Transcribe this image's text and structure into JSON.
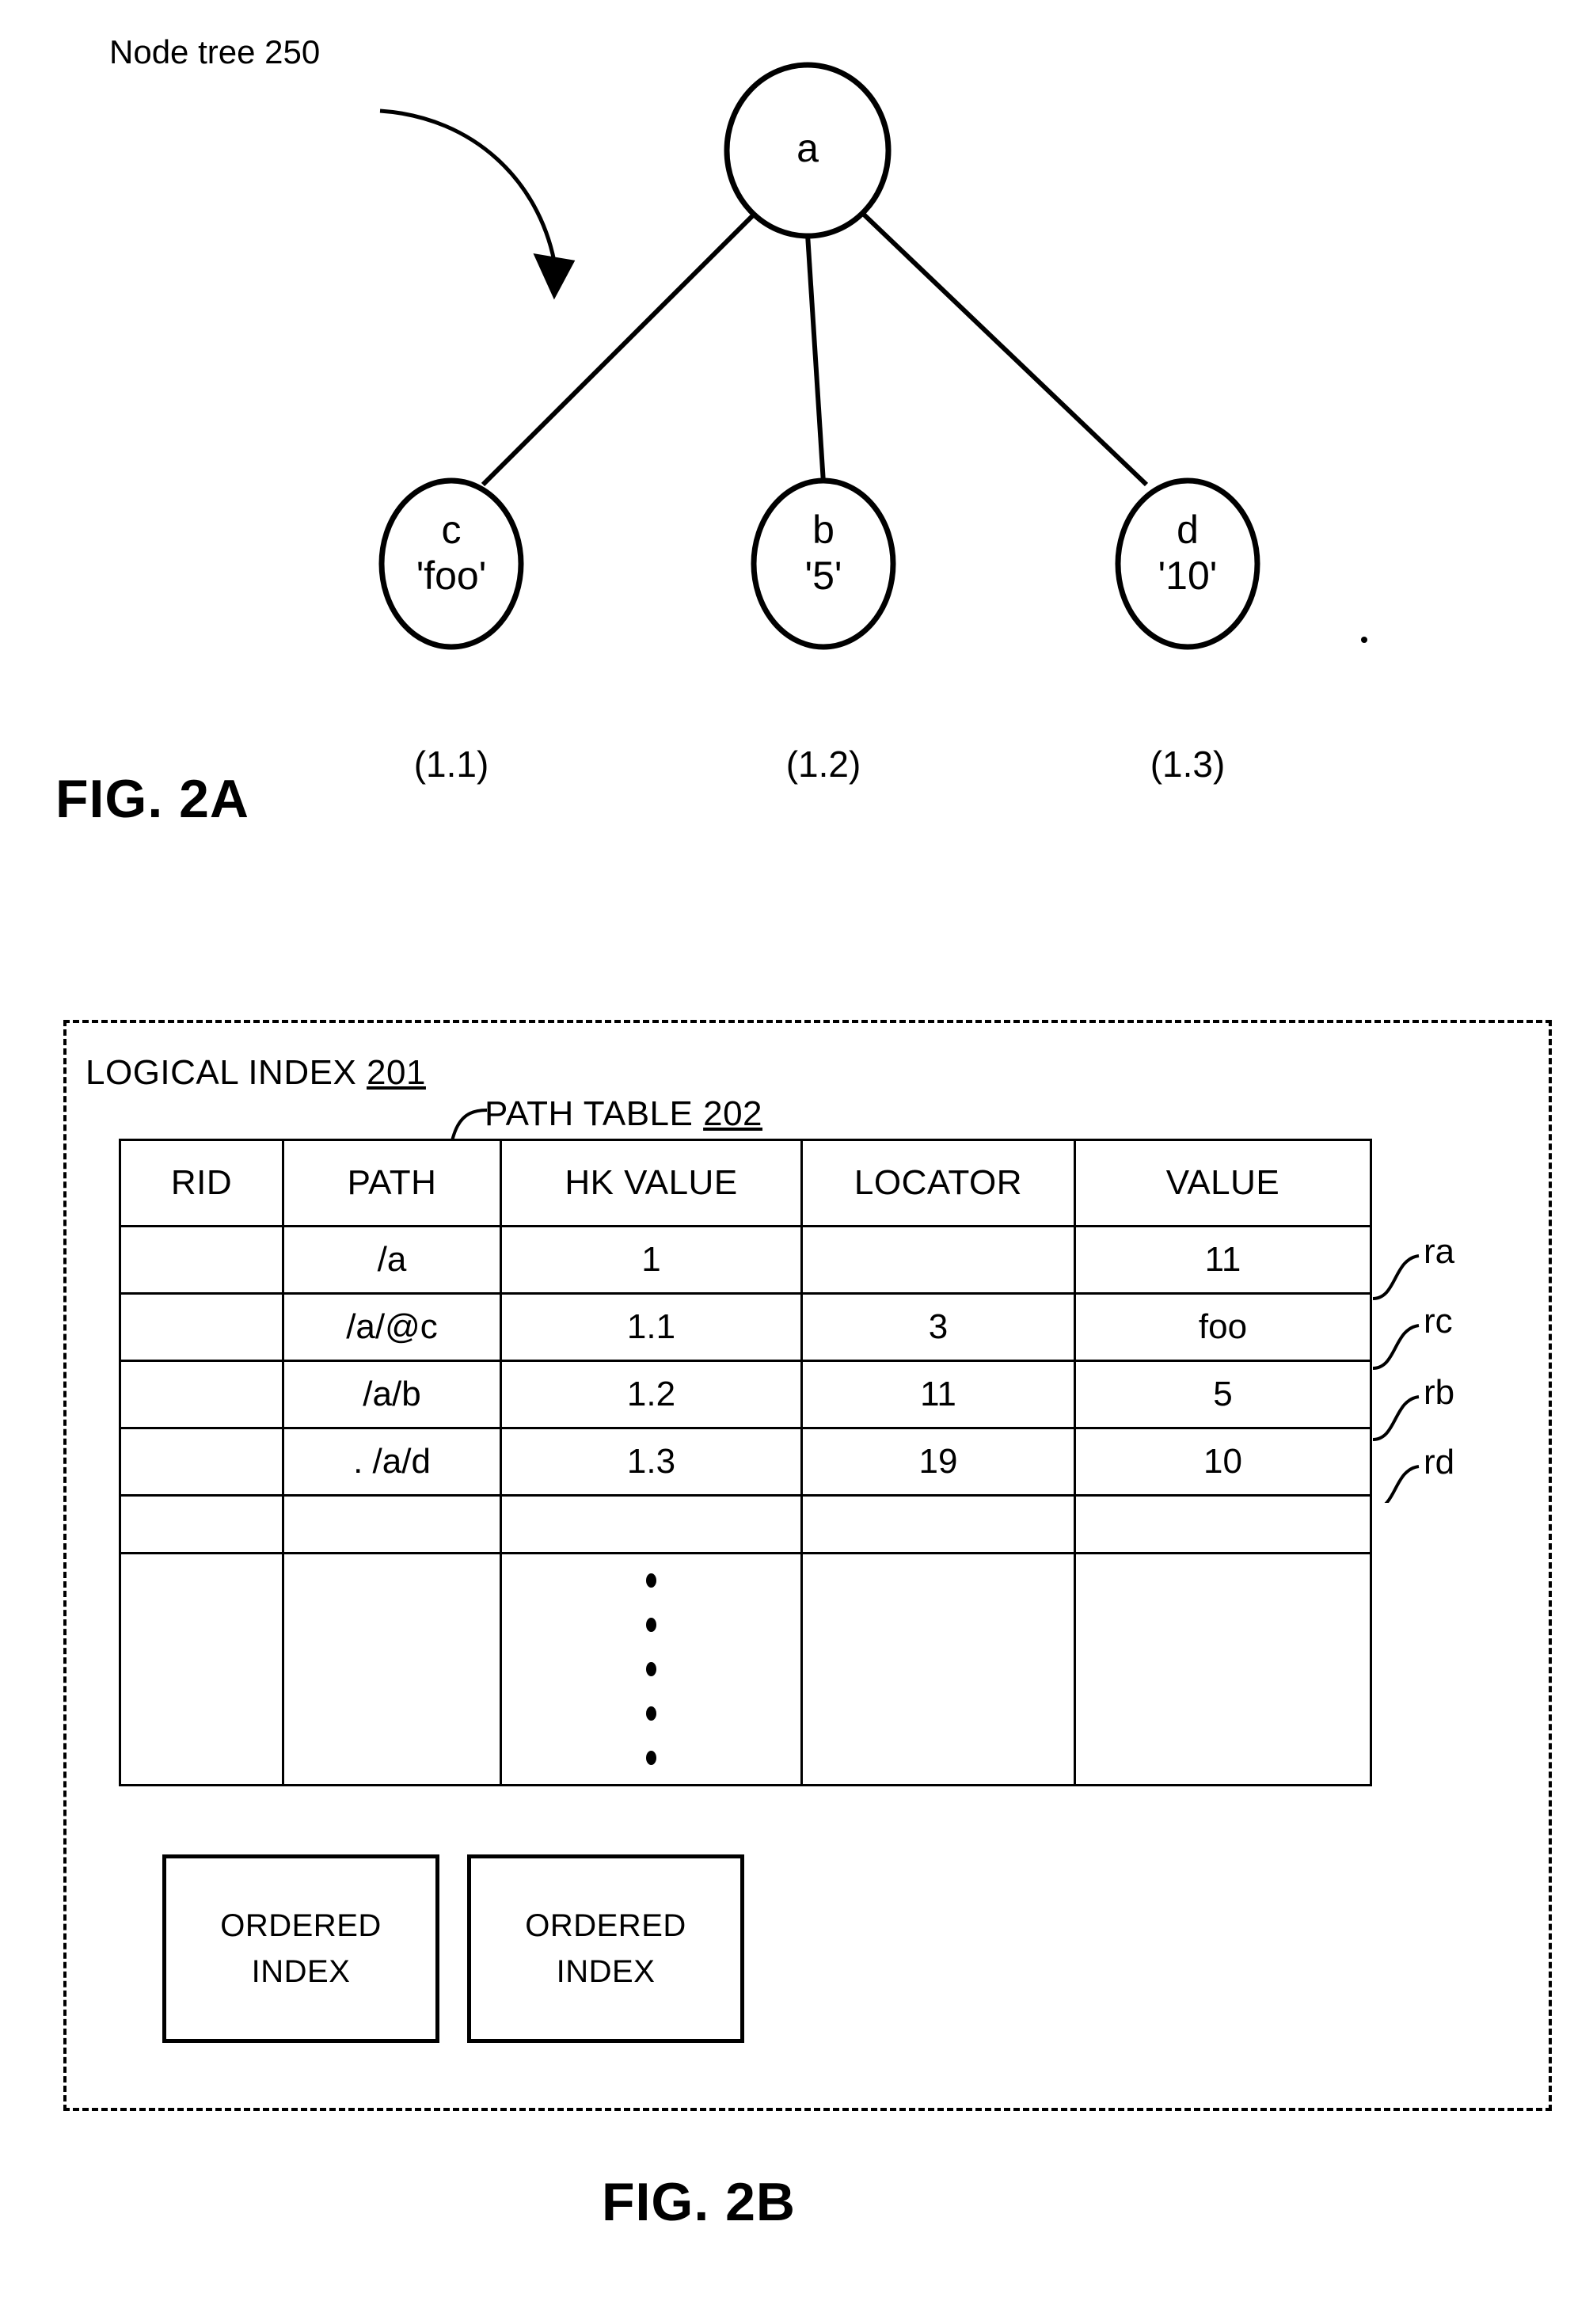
{
  "figures": {
    "fig2a": {
      "label": "FIG. 2A",
      "callout": "Node tree  250",
      "tree": {
        "root": {
          "name": "a",
          "value": ""
        },
        "children": [
          {
            "name": "c",
            "value": "'foo'",
            "hk": "(1.1)"
          },
          {
            "name": "b",
            "value": "'5'",
            "hk": "(1.2)"
          },
          {
            "name": "d",
            "value": "'10'",
            "hk": "(1.3)"
          }
        ]
      }
    },
    "fig2b": {
      "label": "FIG. 2B",
      "logical_index_label": "LOGICAL INDEX ",
      "logical_index_ref": "201",
      "path_table_label": "PATH TABLE ",
      "path_table_ref": "202",
      "table": {
        "headers": [
          "RID",
          "PATH",
          "HK VALUE",
          "LOCATOR",
          "VALUE"
        ],
        "rows": [
          {
            "rid": "",
            "path": "/a",
            "hk_value": "1",
            "locator": "",
            "value": "11",
            "marker": "ra"
          },
          {
            "rid": "",
            "path": "/a/@c",
            "hk_value": "1.1",
            "locator": "3",
            "value": "foo",
            "marker": "rc"
          },
          {
            "rid": "",
            "path": "/a/b",
            "hk_value": "1.2",
            "locator": "11",
            "value": "5",
            "marker": "rb"
          },
          {
            "rid": "",
            "path": ". /a/d",
            "hk_value": "1.3",
            "locator": "19",
            "value": "10",
            "marker": "rd"
          },
          {
            "rid": "",
            "path": "",
            "hk_value": "",
            "locator": "",
            "value": "",
            "marker": ""
          }
        ],
        "continuation_symbol": "vertical-ellipsis"
      },
      "ordered_index_boxes": [
        {
          "line1": "ORDERED",
          "line2": "INDEX"
        },
        {
          "line1": "ORDERED",
          "line2": "INDEX"
        }
      ]
    }
  },
  "colors": {
    "ink": "#000000",
    "paper": "#ffffff"
  }
}
